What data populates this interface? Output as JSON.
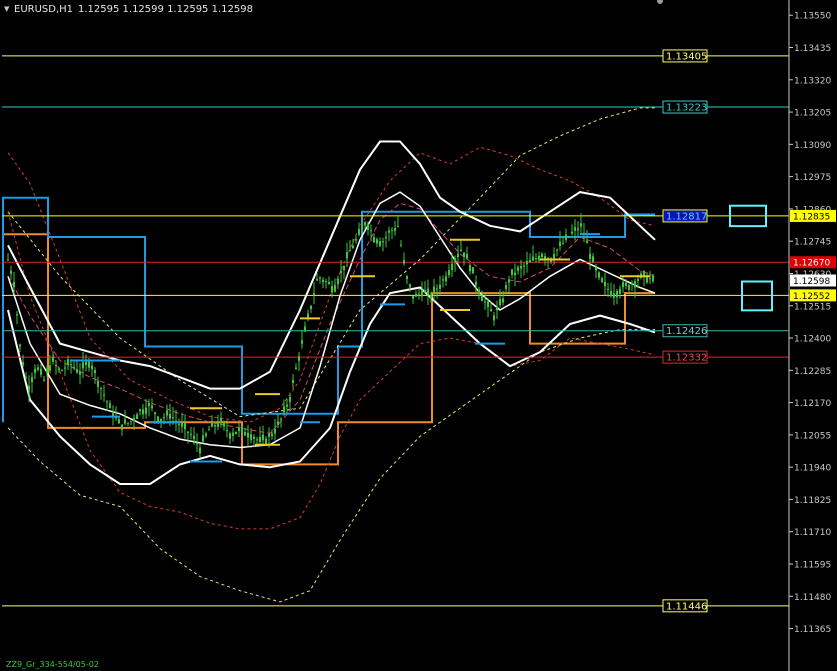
{
  "header": {
    "symbol": "EURUSD,H1",
    "ohlc": "1.12595 1.12599 1.12595 1.12598"
  },
  "footer": {
    "indicator_text": "ZZ9_Gr_334-554/05-02"
  },
  "colors": {
    "background": "#000000",
    "axis": "#c8c8c8",
    "candle": "#3cc83c",
    "bollinger": "#ffffff",
    "red_band": "#d23c3c",
    "yellow_band": "#e6e678",
    "blue_channel": "#1e9be6",
    "orange_channel": "#f08c28",
    "yellow_line": "#ffff64",
    "cyan_line": "#3cc8c8",
    "red_line": "#dc2828"
  },
  "chart_data": {
    "type": "candlestick",
    "ylim": [
      1.1131,
      1.1359
    ],
    "y_ticks": [
      "1.13550",
      "1.13435",
      "1.13320",
      "1.13205",
      "1.13090",
      "1.12975",
      "1.12860",
      "1.12745",
      "1.12630",
      "1.12515",
      "1.12400",
      "1.12285",
      "1.12170",
      "1.12055",
      "1.11940",
      "1.11825",
      "1.11710",
      "1.11595",
      "1.11480",
      "1.11365"
    ],
    "price_tags": [
      {
        "text": "1.12835",
        "bg": "#ffff00",
        "fg": "#000000",
        "value": 1.12835
      },
      {
        "text": "1.12670",
        "bg": "#dc0000",
        "fg": "#ffffff",
        "value": 1.1267
      },
      {
        "text": "1.12598",
        "bg": "#ffffff",
        "fg": "#000000",
        "value": 1.12605
      },
      {
        "text": "1.12552",
        "bg": "#ffff00",
        "fg": "#000000",
        "value": 1.12552
      }
    ],
    "levels": [
      {
        "value": 1.13405,
        "label": "1.13405",
        "color": "#ffff64",
        "label_bg": "#000000",
        "label_fg": "#ffff64"
      },
      {
        "value": 1.13223,
        "label": "1.13223",
        "color": "#3cc8c8",
        "label_bg": "#000000",
        "label_fg": "#3cc8c8"
      },
      {
        "value": 1.12835,
        "label": "1.12817",
        "color": "#ffff00",
        "label_bg": "#0a14b4",
        "label_fg": "#64c8ff"
      },
      {
        "value": 1.1267,
        "label": "",
        "color": "#dc2828"
      },
      {
        "value": 1.12552,
        "label": "",
        "color": "#ffff00"
      },
      {
        "value": 1.12426,
        "label": "1.12426",
        "color": "#3cb4b4",
        "label_bg": "#000000",
        "label_fg": "#78c8c8"
      },
      {
        "value": 1.12332,
        "label": "1.12332",
        "color": "#dc2828",
        "label_bg": "#000000",
        "label_fg": "#dc5050"
      },
      {
        "value": 1.11446,
        "label": "1.11446",
        "color": "#ffff64",
        "label_bg": "#000000",
        "label_fg": "#ffff64"
      }
    ],
    "price_path": [
      [
        8,
        1.1268
      ],
      [
        14,
        1.126
      ],
      [
        20,
        1.1237
      ],
      [
        28,
        1.1222
      ],
      [
        36,
        1.123
      ],
      [
        44,
        1.1225
      ],
      [
        52,
        1.1232
      ],
      [
        60,
        1.1228
      ],
      [
        70,
        1.1231
      ],
      [
        80,
        1.1228
      ],
      [
        90,
        1.1232
      ],
      [
        100,
        1.1223
      ],
      [
        110,
        1.1215
      ],
      [
        120,
        1.1209
      ],
      [
        130,
        1.121
      ],
      [
        140,
        1.1214
      ],
      [
        150,
        1.1216
      ],
      [
        160,
        1.1211
      ],
      [
        170,
        1.1213
      ],
      [
        180,
        1.1209
      ],
      [
        190,
        1.1206
      ],
      [
        200,
        1.1201
      ],
      [
        210,
        1.1208
      ],
      [
        220,
        1.121
      ],
      [
        230,
        1.1206
      ],
      [
        240,
        1.1207
      ],
      [
        250,
        1.1206
      ],
      [
        260,
        1.1203
      ],
      [
        270,
        1.1205
      ],
      [
        280,
        1.121
      ],
      [
        290,
        1.1219
      ],
      [
        296,
        1.1229
      ],
      [
        302,
        1.1238
      ],
      [
        310,
        1.125
      ],
      [
        318,
        1.1262
      ],
      [
        326,
        1.126
      ],
      [
        334,
        1.1258
      ],
      [
        342,
        1.1264
      ],
      [
        350,
        1.1271
      ],
      [
        358,
        1.1276
      ],
      [
        366,
        1.1282
      ],
      [
        374,
        1.1276
      ],
      [
        382,
        1.1274
      ],
      [
        390,
        1.1278
      ],
      [
        398,
        1.128
      ],
      [
        406,
        1.1262
      ],
      [
        414,
        1.1254
      ],
      [
        422,
        1.1257
      ],
      [
        430,
        1.1255
      ],
      [
        438,
        1.1258
      ],
      [
        446,
        1.1262
      ],
      [
        454,
        1.1268
      ],
      [
        462,
        1.1272
      ],
      [
        470,
        1.1266
      ],
      [
        478,
        1.1258
      ],
      [
        486,
        1.1252
      ],
      [
        494,
        1.1248
      ],
      [
        502,
        1.1253
      ],
      [
        510,
        1.1262
      ],
      [
        518,
        1.1264
      ],
      [
        526,
        1.1266
      ],
      [
        534,
        1.1268
      ],
      [
        542,
        1.127
      ],
      [
        550,
        1.1268
      ],
      [
        558,
        1.1272
      ],
      [
        566,
        1.1275
      ],
      [
        574,
        1.1278
      ],
      [
        582,
        1.128
      ],
      [
        590,
        1.127
      ],
      [
        598,
        1.1262
      ],
      [
        606,
        1.1258
      ],
      [
        614,
        1.1256
      ],
      [
        622,
        1.1258
      ],
      [
        630,
        1.1259
      ],
      [
        638,
        1.1261
      ],
      [
        646,
        1.1262
      ],
      [
        654,
        1.126
      ]
    ],
    "bollinger_upper": [
      [
        8,
        1.1273
      ],
      [
        30,
        1.1258
      ],
      [
        60,
        1.1238
      ],
      [
        90,
        1.1235
      ],
      [
        120,
        1.1232
      ],
      [
        150,
        1.123
      ],
      [
        180,
        1.1226
      ],
      [
        210,
        1.1222
      ],
      [
        240,
        1.1222
      ],
      [
        270,
        1.1228
      ],
      [
        300,
        1.125
      ],
      [
        330,
        1.1275
      ],
      [
        360,
        1.13
      ],
      [
        380,
        1.131
      ],
      [
        400,
        1.131
      ],
      [
        420,
        1.1302
      ],
      [
        440,
        1.129
      ],
      [
        460,
        1.1285
      ],
      [
        490,
        1.128
      ],
      [
        520,
        1.1278
      ],
      [
        550,
        1.1285
      ],
      [
        580,
        1.1292
      ],
      [
        610,
        1.129
      ],
      [
        640,
        1.128
      ],
      [
        655,
        1.1275
      ]
    ],
    "bollinger_middle": [
      [
        8,
        1.1262
      ],
      [
        30,
        1.1248
      ],
      [
        60,
        1.1232
      ],
      [
        90,
        1.1226
      ],
      [
        120,
        1.1222
      ],
      [
        150,
        1.1217
      ],
      [
        180,
        1.1213
      ],
      [
        210,
        1.121
      ],
      [
        240,
        1.1208
      ],
      [
        270,
        1.1206
      ],
      [
        300,
        1.1218
      ],
      [
        330,
        1.1245
      ],
      [
        360,
        1.1268
      ],
      [
        380,
        1.1282
      ],
      [
        400,
        1.1288
      ],
      [
        420,
        1.1286
      ],
      [
        440,
        1.1278
      ],
      [
        460,
        1.127
      ],
      [
        490,
        1.1262
      ],
      [
        520,
        1.126
      ],
      [
        550,
        1.1265
      ],
      [
        580,
        1.1276
      ],
      [
        610,
        1.1272
      ],
      [
        640,
        1.1264
      ],
      [
        655,
        1.1262
      ]
    ],
    "bollinger_lower": [
      [
        8,
        1.125
      ],
      [
        30,
        1.1218
      ],
      [
        60,
        1.1205
      ],
      [
        90,
        1.1195
      ],
      [
        120,
        1.1188
      ],
      [
        150,
        1.1188
      ],
      [
        180,
        1.1195
      ],
      [
        210,
        1.1198
      ],
      [
        240,
        1.1195
      ],
      [
        270,
        1.1194
      ],
      [
        300,
        1.1196
      ],
      [
        330,
        1.1208
      ],
      [
        350,
        1.1228
      ],
      [
        370,
        1.1245
      ],
      [
        390,
        1.1256
      ],
      [
        420,
        1.1258
      ],
      [
        450,
        1.1248
      ],
      [
        480,
        1.1238
      ],
      [
        510,
        1.123
      ],
      [
        540,
        1.1235
      ],
      [
        570,
        1.1245
      ],
      [
        600,
        1.1248
      ],
      [
        630,
        1.1245
      ],
      [
        655,
        1.1242
      ]
    ],
    "bollinger_inner": [
      [
        8,
        1.1262
      ],
      [
        30,
        1.1238
      ],
      [
        60,
        1.122
      ],
      [
        90,
        1.1216
      ],
      [
        120,
        1.1213
      ],
      [
        150,
        1.1208
      ],
      [
        180,
        1.1204
      ],
      [
        210,
        1.1202
      ],
      [
        240,
        1.1201
      ],
      [
        270,
        1.1202
      ],
      [
        300,
        1.1208
      ],
      [
        320,
        1.123
      ],
      [
        340,
        1.1255
      ],
      [
        360,
        1.1275
      ],
      [
        380,
        1.1288
      ],
      [
        400,
        1.1292
      ],
      [
        420,
        1.1287
      ],
      [
        440,
        1.1276
      ],
      [
        460,
        1.1265
      ],
      [
        480,
        1.1256
      ],
      [
        500,
        1.125
      ],
      [
        520,
        1.1254
      ],
      [
        550,
        1.1262
      ],
      [
        580,
        1.1268
      ],
      [
        610,
        1.1263
      ],
      [
        640,
        1.1258
      ],
      [
        655,
        1.1256
      ]
    ],
    "red_upper": [
      [
        8,
        1.1306
      ],
      [
        30,
        1.1295
      ],
      [
        60,
        1.1268
      ],
      [
        90,
        1.124
      ],
      [
        130,
        1.1225
      ],
      [
        170,
        1.1218
      ],
      [
        210,
        1.1212
      ],
      [
        250,
        1.121
      ],
      [
        280,
        1.1215
      ],
      [
        300,
        1.1225
      ],
      [
        330,
        1.1255
      ],
      [
        360,
        1.128
      ],
      [
        390,
        1.1296
      ],
      [
        420,
        1.1306
      ],
      [
        450,
        1.1302
      ],
      [
        480,
        1.1308
      ],
      [
        510,
        1.1305
      ],
      [
        540,
        1.13
      ],
      [
        570,
        1.1296
      ],
      [
        600,
        1.129
      ],
      [
        630,
        1.1282
      ],
      [
        655,
        1.128
      ]
    ],
    "red_lower": [
      [
        8,
        1.1285
      ],
      [
        30,
        1.1255
      ],
      [
        60,
        1.1228
      ],
      [
        90,
        1.12
      ],
      [
        120,
        1.1185
      ],
      [
        150,
        1.118
      ],
      [
        180,
        1.1178
      ],
      [
        210,
        1.1174
      ],
      [
        240,
        1.1172
      ],
      [
        270,
        1.1172
      ],
      [
        300,
        1.1176
      ],
      [
        320,
        1.1188
      ],
      [
        340,
        1.1205
      ],
      [
        360,
        1.1218
      ],
      [
        390,
        1.1228
      ],
      [
        420,
        1.1238
      ],
      [
        450,
        1.124
      ],
      [
        480,
        1.1238
      ],
      [
        510,
        1.123
      ],
      [
        540,
        1.1232
      ],
      [
        570,
        1.124
      ],
      [
        600,
        1.1238
      ],
      [
        630,
        1.1236
      ],
      [
        655,
        1.1234
      ]
    ],
    "yellow_upper": [
      [
        8,
        1.1285
      ],
      [
        60,
        1.1262
      ],
      [
        120,
        1.124
      ],
      [
        180,
        1.1225
      ],
      [
        240,
        1.1212
      ],
      [
        300,
        1.1215
      ],
      [
        360,
        1.125
      ],
      [
        420,
        1.1268
      ],
      [
        480,
        1.129
      ],
      [
        520,
        1.1305
      ],
      [
        560,
        1.1312
      ],
      [
        600,
        1.1318
      ],
      [
        640,
        1.1322
      ],
      [
        655,
        1.1322
      ]
    ],
    "yellow_lower": [
      [
        8,
        1.1208
      ],
      [
        40,
        1.1196
      ],
      [
        80,
        1.1184
      ],
      [
        120,
        1.118
      ],
      [
        160,
        1.1165
      ],
      [
        200,
        1.1155
      ],
      [
        240,
        1.115
      ],
      [
        280,
        1.1146
      ],
      [
        310,
        1.115
      ],
      [
        340,
        1.1168
      ],
      [
        380,
        1.119
      ],
      [
        420,
        1.1205
      ],
      [
        460,
        1.1215
      ],
      [
        500,
        1.1225
      ],
      [
        540,
        1.1235
      ],
      [
        580,
        1.124
      ],
      [
        620,
        1.1243
      ],
      [
        655,
        1.1243
      ]
    ],
    "blue_channel": [
      [
        3,
        1.121
      ],
      [
        3,
        1.129
      ],
      [
        48,
        1.129
      ],
      [
        48,
        1.1276
      ],
      [
        145,
        1.1276
      ],
      [
        145,
        1.1237
      ],
      [
        242,
        1.1237
      ],
      [
        242,
        1.1213
      ],
      [
        338,
        1.1213
      ],
      [
        338,
        1.1237
      ],
      [
        362,
        1.1237
      ],
      [
        362,
        1.1285
      ],
      [
        434,
        1.1285
      ],
      [
        434,
        1.1285
      ],
      [
        530,
        1.1285
      ],
      [
        530,
        1.1276
      ],
      [
        625,
        1.1276
      ],
      [
        625,
        1.1284
      ],
      [
        655,
        1.1284
      ]
    ],
    "orange_channel": [
      [
        3,
        1.1277
      ],
      [
        48,
        1.1277
      ],
      [
        48,
        1.1208
      ],
      [
        145,
        1.1208
      ],
      [
        145,
        1.121
      ],
      [
        242,
        1.121
      ],
      [
        242,
        1.1195
      ],
      [
        338,
        1.1195
      ],
      [
        338,
        1.121
      ],
      [
        432,
        1.121
      ],
      [
        432,
        1.1256
      ],
      [
        530,
        1.1256
      ],
      [
        530,
        1.1238
      ],
      [
        625,
        1.1238
      ],
      [
        625,
        1.1256
      ],
      [
        655,
        1.1256
      ]
    ],
    "markers": [
      {
        "x0": 70,
        "x1": 120,
        "v": 1.1232,
        "c": "#1e9be6"
      },
      {
        "x0": 92,
        "x1": 120,
        "v": 1.1212,
        "c": "#1e9be6"
      },
      {
        "x0": 150,
        "x1": 180,
        "v": 1.121,
        "c": "#1e9be6"
      },
      {
        "x0": 190,
        "x1": 222,
        "v": 1.1215,
        "c": "#f0c828"
      },
      {
        "x0": 190,
        "x1": 222,
        "v": 1.1196,
        "c": "#1e9be6"
      },
      {
        "x0": 255,
        "x1": 280,
        "v": 1.122,
        "c": "#f0c828"
      },
      {
        "x0": 255,
        "x1": 280,
        "v": 1.1202,
        "c": "#f0c828"
      },
      {
        "x0": 300,
        "x1": 320,
        "v": 1.1247,
        "c": "#f0c828"
      },
      {
        "x0": 300,
        "x1": 320,
        "v": 1.121,
        "c": "#1e9be6"
      },
      {
        "x0": 350,
        "x1": 375,
        "v": 1.1262,
        "c": "#f0c828"
      },
      {
        "x0": 380,
        "x1": 405,
        "v": 1.1252,
        "c": "#1e9be6"
      },
      {
        "x0": 440,
        "x1": 470,
        "v": 1.125,
        "c": "#f0c828"
      },
      {
        "x0": 450,
        "x1": 480,
        "v": 1.1275,
        "c": "#f0c828"
      },
      {
        "x0": 475,
        "x1": 505,
        "v": 1.1238,
        "c": "#1e9be6"
      },
      {
        "x0": 540,
        "x1": 570,
        "v": 1.1268,
        "c": "#f0c828"
      },
      {
        "x0": 580,
        "x1": 600,
        "v": 1.1277,
        "c": "#1e9be6"
      },
      {
        "x0": 620,
        "x1": 650,
        "v": 1.1262,
        "c": "#f0c828"
      }
    ],
    "cyan_boxes": [
      {
        "x0": 730,
        "x1": 766,
        "v0": 1.1285,
        "v1": 1.1282
      },
      {
        "x0": 742,
        "x1": 772,
        "v0": 1.1258,
        "v1": 1.1252
      }
    ]
  }
}
